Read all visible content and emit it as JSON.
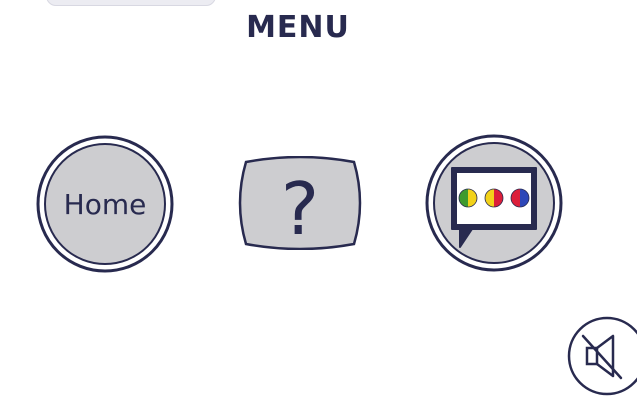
{
  "menu": {
    "title": "MENU"
  },
  "buttons": {
    "home_label": "Home",
    "help_label": "?",
    "language_icon": "speech-bubble-colored-dots-icon",
    "mute_icon": "speaker-muted-icon"
  },
  "colors": {
    "navy": "#282a4f",
    "button_fill": "#cdcdd0",
    "dot_green": "#3f9a2e",
    "dot_yellow": "#f2d21a",
    "dot_red": "#dc1f3a",
    "dot_blue": "#2d47b8"
  }
}
